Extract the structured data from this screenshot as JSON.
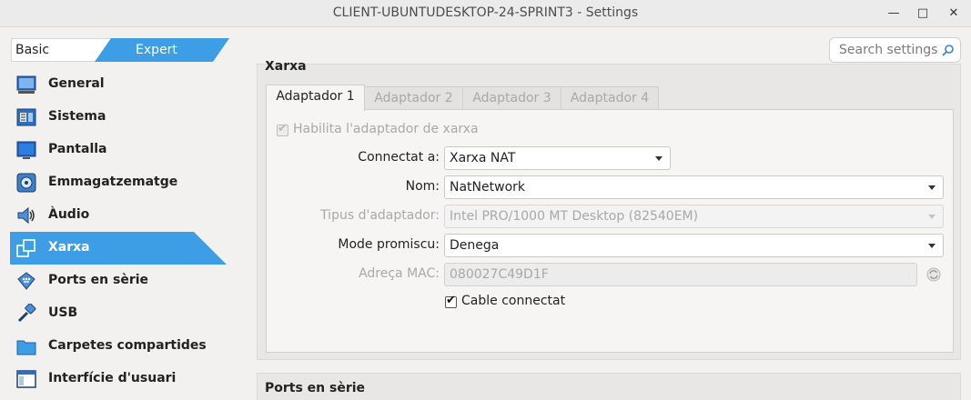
{
  "window": {
    "title": "CLIENT-UBUNTUDESKTOP-24-SPRINT3 - Settings",
    "minimize_glyph": "—",
    "maximize_glyph": "□",
    "close_glyph": "✕"
  },
  "mode": {
    "basic_label": "Basic",
    "expert_label": "Expert",
    "selected": "Expert"
  },
  "search": {
    "placeholder": "Search settings"
  },
  "sidebar": {
    "items": [
      {
        "label": "General",
        "icon": "monitor-general-icon"
      },
      {
        "label": "Sistema",
        "icon": "chip-system-icon"
      },
      {
        "label": "Pantalla",
        "icon": "display-icon"
      },
      {
        "label": "Emmagatzematge",
        "icon": "disk-storage-icon"
      },
      {
        "label": "Àudio",
        "icon": "speaker-icon"
      },
      {
        "label": "Xarxa",
        "icon": "network-icon",
        "active": true
      },
      {
        "label": "Ports en sèrie",
        "icon": "serial-port-icon"
      },
      {
        "label": "USB",
        "icon": "usb-icon"
      },
      {
        "label": "Carpetes compartides",
        "icon": "folder-icon"
      },
      {
        "label": "Interfície d'usuari",
        "icon": "window-ui-icon"
      }
    ]
  },
  "network": {
    "section_title": "Xarxa",
    "tabs": [
      {
        "label": "Adaptador 1",
        "active": true
      },
      {
        "label": "Adaptador 2"
      },
      {
        "label": "Adaptador 3"
      },
      {
        "label": "Adaptador 4"
      }
    ],
    "enable_adapter_label": "Habilita l'adaptador de xarxa",
    "enable_adapter_checked": true,
    "attached_to_label": "Connectat a:",
    "attached_to_value": "Xarxa NAT",
    "name_label": "Nom:",
    "name_value": "NatNetwork",
    "adapter_type_label": "Tipus d'adaptador:",
    "adapter_type_value": "Intel PRO/1000 MT Desktop (82540EM)",
    "promiscuous_label": "Mode promiscu:",
    "promiscuous_value": "Denega",
    "mac_label": "Adreça MAC:",
    "mac_value": "080027C49D1F",
    "cable_label": "Cable connectat",
    "cable_checked": true
  },
  "next_section": {
    "title": "Ports en sèrie"
  },
  "colors": {
    "accent": "#3d9ee5",
    "accent_dark": "#2f8ad6",
    "panel": "#e8e7e6",
    "background": "#f2f1f0"
  }
}
